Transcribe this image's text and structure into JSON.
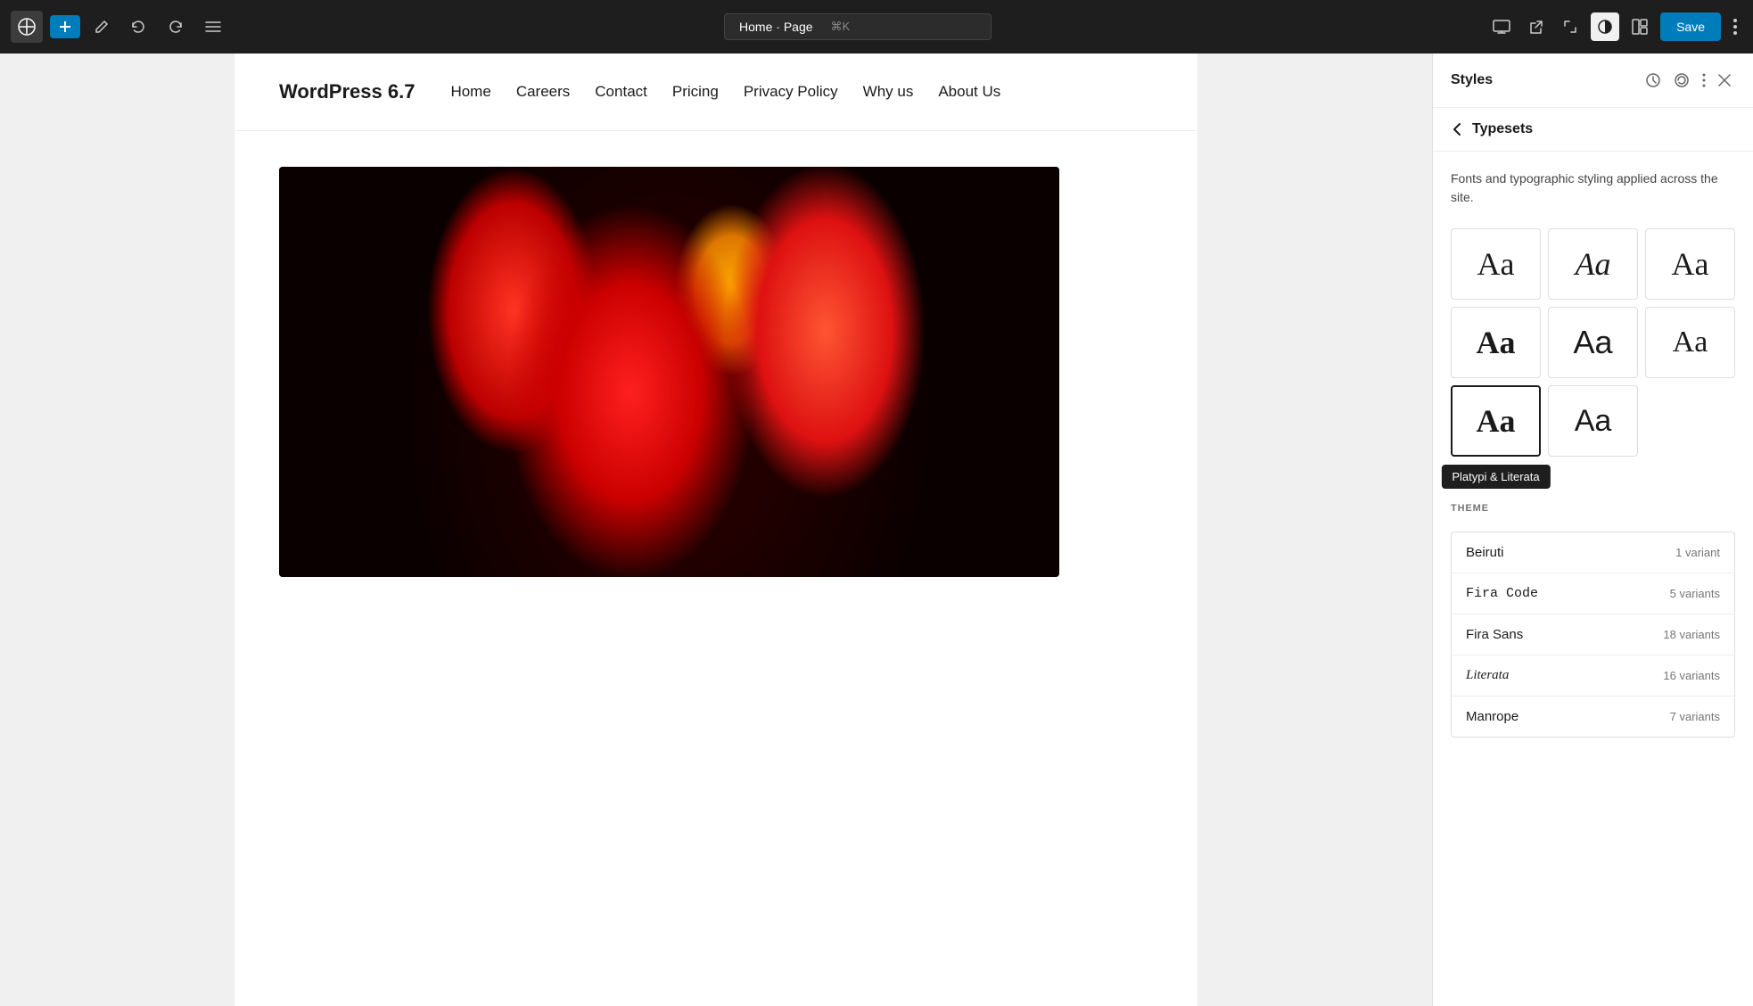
{
  "toolbar": {
    "address": "Home · Page",
    "shortcut": "⌘K",
    "save_label": "Save"
  },
  "site": {
    "logo": "WordPress 6.7",
    "nav": [
      "Home",
      "Careers",
      "Contact",
      "Pricing",
      "Privacy Policy",
      "Why us",
      "About Us"
    ]
  },
  "panel": {
    "title": "Styles",
    "sub_title": "Typesets",
    "description": "Fonts and typographic styling applied across the site.",
    "theme_label": "THEME",
    "tooltip": "Platypi & Literata",
    "typesets": [
      {
        "label": "Aa"
      },
      {
        "label": "Aa"
      },
      {
        "label": "Aa"
      },
      {
        "label": "Aa"
      },
      {
        "label": "Aa"
      },
      {
        "label": "Aa"
      },
      {
        "label": "Aa"
      },
      {
        "label": "Aa"
      }
    ],
    "fonts": [
      {
        "name": "Beiruti",
        "variants": "1 variant",
        "mono": false
      },
      {
        "name": "Fira Code",
        "variants": "5 variants",
        "mono": true
      },
      {
        "name": "Fira Sans",
        "variants": "18 variants",
        "mono": false
      },
      {
        "name": "Literata",
        "variants": "16 variants",
        "mono": false,
        "serif": true
      },
      {
        "name": "Manrope",
        "variants": "7 variants",
        "mono": false
      }
    ]
  }
}
